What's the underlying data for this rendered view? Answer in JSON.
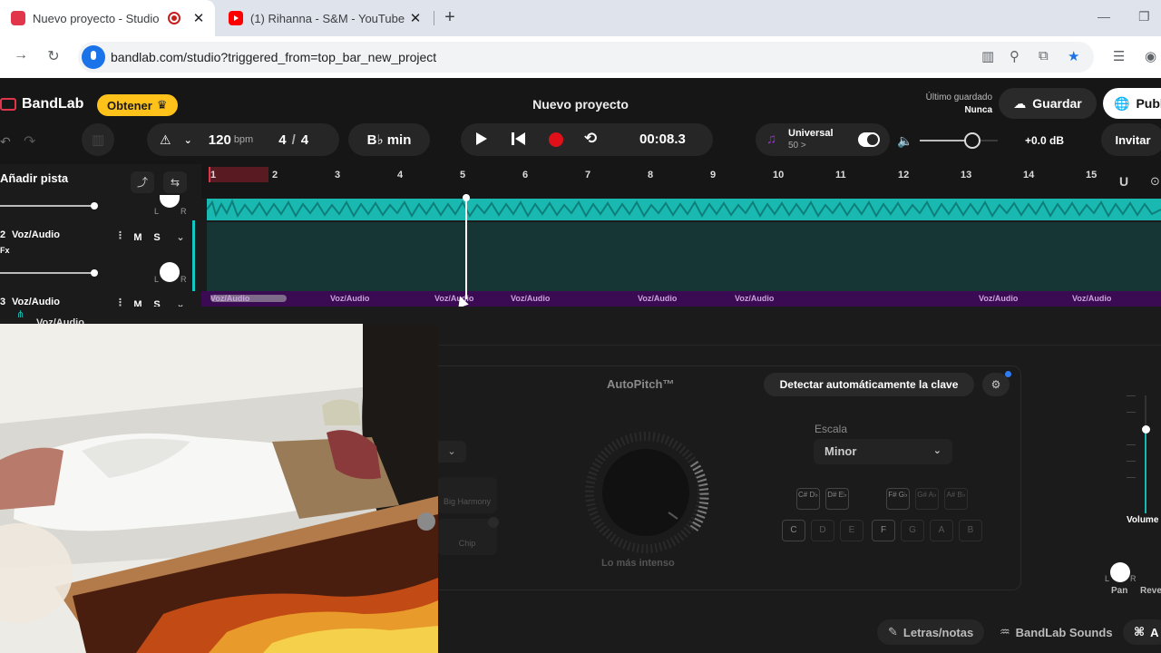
{
  "browser": {
    "tabs": [
      {
        "title": "Nuevo proyecto - Studio",
        "active": true
      },
      {
        "title": "(1) Rihanna - S&M - YouTube",
        "active": false
      }
    ],
    "url": "bandlab.com/studio?triggered_from=top_bar_new_project"
  },
  "header": {
    "brand": "BandLab",
    "get_label": "Obtener",
    "project_title": "Nuevo proyecto",
    "last_saved_label": "Último guardado",
    "last_saved_value": "Nunca",
    "save_label": "Guardar",
    "publish_label": "Publ"
  },
  "transport": {
    "bpm_value": "120",
    "bpm_unit": "bpm",
    "time_sig_num": "4",
    "time_sig_sep": "/",
    "time_sig_den": "4",
    "key": "B♭ min",
    "time": "00:08.3",
    "universal_label": "Universal",
    "universal_sub": "50 >",
    "volume_db": "+0.0 dB",
    "invite_label": "Invitar"
  },
  "tracks_panel": {
    "add_track_label": "Añadir pista",
    "tracks": [
      {
        "number": "2",
        "name": "Voz/Audio",
        "fx": "Fx",
        "mute": "M",
        "solo": "S"
      },
      {
        "number": "3",
        "name": "Voz/Audio",
        "mute": "M",
        "solo": "S"
      },
      {
        "name": "Voz/Audio"
      }
    ],
    "pan_left": "L",
    "pan_right": "R"
  },
  "ruler": {
    "bars": [
      "1",
      "2",
      "3",
      "4",
      "5",
      "6",
      "7",
      "8",
      "9",
      "10",
      "11",
      "12",
      "13",
      "14",
      "15"
    ]
  },
  "clips": {
    "label": "Voz/Audio"
  },
  "effects": {
    "autopitch_title": "AutoPitch™",
    "detect_key_label": "Detectar automáticamente la clave",
    "scale_label": "Escala",
    "scale_value": "Minor",
    "knob_caption": "Lo más intenso",
    "options": [
      "Big Harmony",
      "Chip"
    ],
    "sharp_keys": [
      "C# D♭",
      "D# E♭",
      "F# G♭",
      "G# A♭",
      "A# B♭"
    ],
    "natural_keys": [
      "C",
      "D",
      "E",
      "F",
      "G",
      "A",
      "B"
    ]
  },
  "mixer": {
    "volume_label": "Volume",
    "pan_label": "Pan",
    "reverb_label": "Reve",
    "pan_left": "L",
    "pan_right": "R"
  },
  "footer": {
    "lyrics_label": "Letras/notas",
    "sounds_label": "BandLab Sounds",
    "ai_label": "A"
  },
  "colors": {
    "accent_teal": "#19b9b2",
    "clip_purple": "#3a0a52",
    "record_red": "#e0354b",
    "get_yellow": "#ffc21a"
  }
}
